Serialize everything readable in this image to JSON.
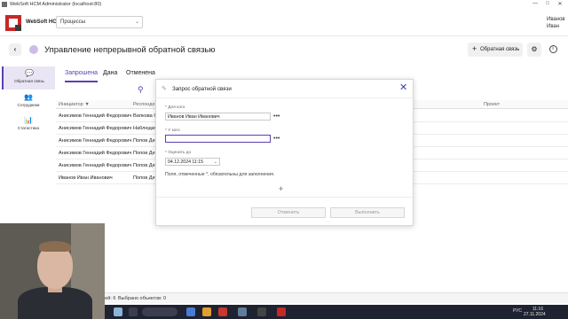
{
  "window": {
    "title": "WebSoft HCM Administrator (localhost:80)",
    "minimize": "—",
    "maximize": "□",
    "close": "✕"
  },
  "header": {
    "brand": "WebSoft HCM",
    "process_select": "Процессы",
    "user_name": "Иванов Иван"
  },
  "page": {
    "title": "Управление непрерывной обратной связью",
    "back": "‹",
    "feedback_button": "Обратная связь",
    "plus": "+",
    "settings": "⚙",
    "info": "i"
  },
  "nav": {
    "items": [
      {
        "label": "Обратная связь",
        "icon": "chat-icon",
        "glyph": "💬"
      },
      {
        "label": "Сотрудники",
        "icon": "people-icon",
        "glyph": "👥"
      },
      {
        "label": "Статистика",
        "icon": "chart-icon",
        "glyph": "📊"
      }
    ]
  },
  "tabs": [
    {
      "label": "Запрошена"
    },
    {
      "label": "Дана"
    },
    {
      "label": "Отменена"
    }
  ],
  "grid": {
    "headers": {
      "initiator": "Инициатор ▼",
      "respondent": "Респонден",
      "project": "Проект"
    },
    "rows": [
      {
        "initiator": "Анисимов Геннадий Федорович",
        "respondent": "Вилкова О"
      },
      {
        "initiator": "Анисимов Геннадий Федорович",
        "respondent": "Наблюдат"
      },
      {
        "initiator": "Анисимов Геннадий Федорович",
        "respondent": "Попов Ден"
      },
      {
        "initiator": "Анисимов Геннадий Федорович",
        "respondent": "Попов Ден"
      },
      {
        "initiator": "Анисимов Геннадий Федорович",
        "respondent": "Попов Ден"
      },
      {
        "initiator": "Иванов Иван Иванович",
        "respondent": "Попов Ден"
      }
    ]
  },
  "status": {
    "count": "Записей: 6",
    "selected": "Выбрано объектов: 0"
  },
  "dialog": {
    "title": "Запрос обратной связи",
    "close": "✕",
    "from_label": "* Для кого",
    "from_value": "Иванов Иван Иванович",
    "to_label": "* У кого",
    "to_value": "",
    "due_label": "* Оценить до",
    "due_value": "04.12.2024 11:15",
    "note": "Поля, отмеченные *, обязательны для заполнения.",
    "dots": "•••",
    "cancel": "Отменить",
    "submit": "Выполнить"
  },
  "taskbar": {
    "lang": "РУС",
    "time": "11:16",
    "date": "27.11.2024"
  },
  "colors": {
    "accent": "#5b3fb3",
    "brand_red": "#c62828",
    "taskbar": "#1f2230"
  }
}
